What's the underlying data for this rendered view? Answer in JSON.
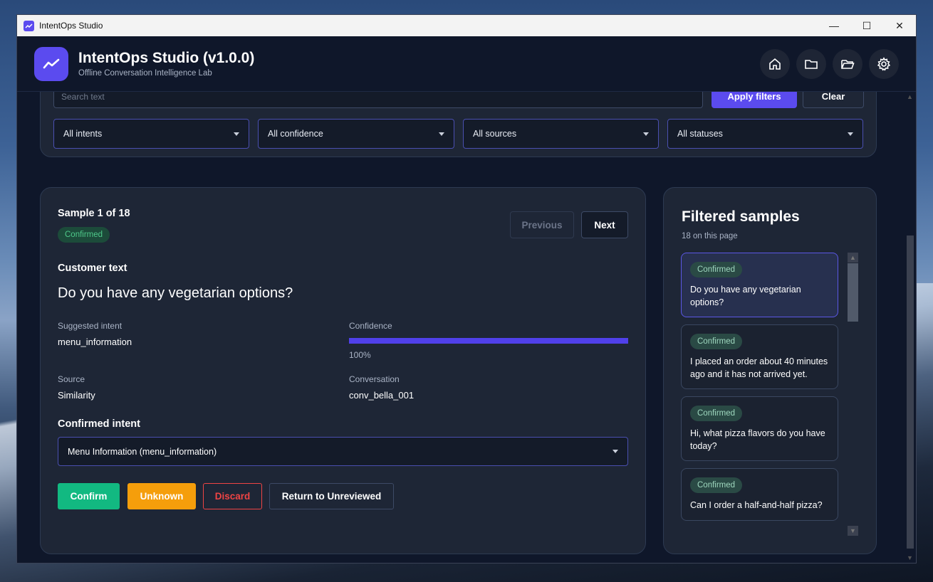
{
  "window": {
    "title": "IntentOps Studio",
    "controls": {
      "minimize": "—",
      "maximize": "☐",
      "close": "✕"
    }
  },
  "header": {
    "title": "IntentOps Studio (v1.0.0)",
    "subtitle": "Offline Conversation Intelligence Lab",
    "icons": [
      "home-icon",
      "folder-icon",
      "folder-open-icon",
      "gear-icon"
    ]
  },
  "filters": {
    "search_placeholder": "Search text",
    "apply_label": "Apply filters",
    "clear_label": "Clear",
    "intent": "All intents",
    "confidence": "All confidence",
    "source": "All sources",
    "status": "All statuses"
  },
  "sample": {
    "title": "Sample 1 of 18",
    "status": "Confirmed",
    "previous_label": "Previous",
    "next_label": "Next",
    "customer_text_label": "Customer text",
    "customer_text": "Do you have any vegetarian options?",
    "suggested_intent_label": "Suggested intent",
    "suggested_intent": "menu_information",
    "confidence_label": "Confidence",
    "confidence_value": "100%",
    "confidence_fraction": 1.0,
    "source_label": "Source",
    "source": "Similarity",
    "conversation_label": "Conversation",
    "conversation": "conv_bella_001",
    "confirmed_intent_label": "Confirmed intent",
    "confirmed_intent": "Menu Information (menu_information)",
    "actions": {
      "confirm": "Confirm",
      "unknown": "Unknown",
      "discard": "Discard",
      "return": "Return to Unreviewed"
    }
  },
  "colors": {
    "accent": "#5b4bef",
    "confirm": "#12b981",
    "unknown": "#f59e0b",
    "discard": "#ef4444"
  },
  "sidebar": {
    "title": "Filtered samples",
    "count": "18 on this page",
    "items": [
      {
        "status": "Confirmed",
        "text": "Do you have any vegetarian options?"
      },
      {
        "status": "Confirmed",
        "text": "I placed an order about 40 minutes ago and it has not arrived yet."
      },
      {
        "status": "Confirmed",
        "text": "Hi, what pizza flavors do you have today?"
      },
      {
        "status": "Confirmed",
        "text": "Can I order a half-and-half pizza?"
      }
    ]
  }
}
